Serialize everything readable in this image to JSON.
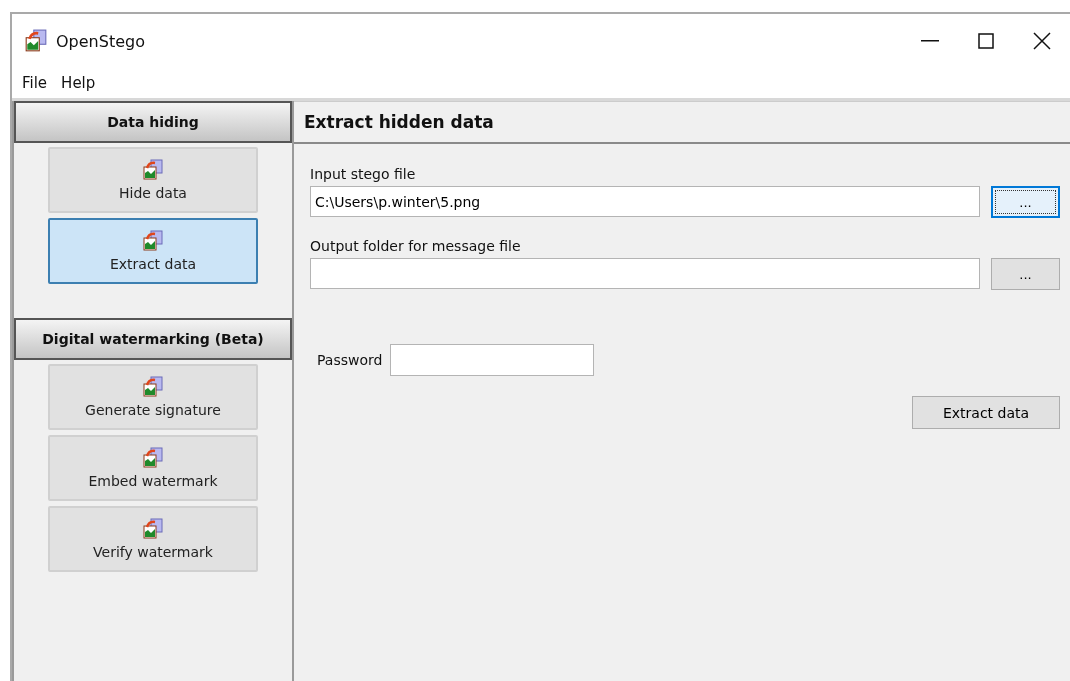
{
  "window": {
    "title": "OpenStego"
  },
  "menu": [
    "File",
    "Help"
  ],
  "sidebar": {
    "sections": [
      {
        "title": "Data hiding",
        "items": [
          {
            "label": "Hide data",
            "selected": false
          },
          {
            "label": "Extract data",
            "selected": true
          }
        ]
      },
      {
        "title": "Digital watermarking (Beta)",
        "items": [
          {
            "label": "Generate signature",
            "selected": false
          },
          {
            "label": "Embed watermark",
            "selected": false
          },
          {
            "label": "Verify watermark",
            "selected": false
          }
        ]
      }
    ]
  },
  "panel": {
    "title": "Extract hidden data",
    "files": [
      {
        "label": "Input stego file",
        "value": "C:\\Users\\p.winter\\5.png",
        "button": "...",
        "focused": true
      },
      {
        "label": "Output folder for message file",
        "button": "...",
        "focused": false
      }
    ],
    "password": {
      "label": "Password"
    },
    "action": "Extract data"
  }
}
